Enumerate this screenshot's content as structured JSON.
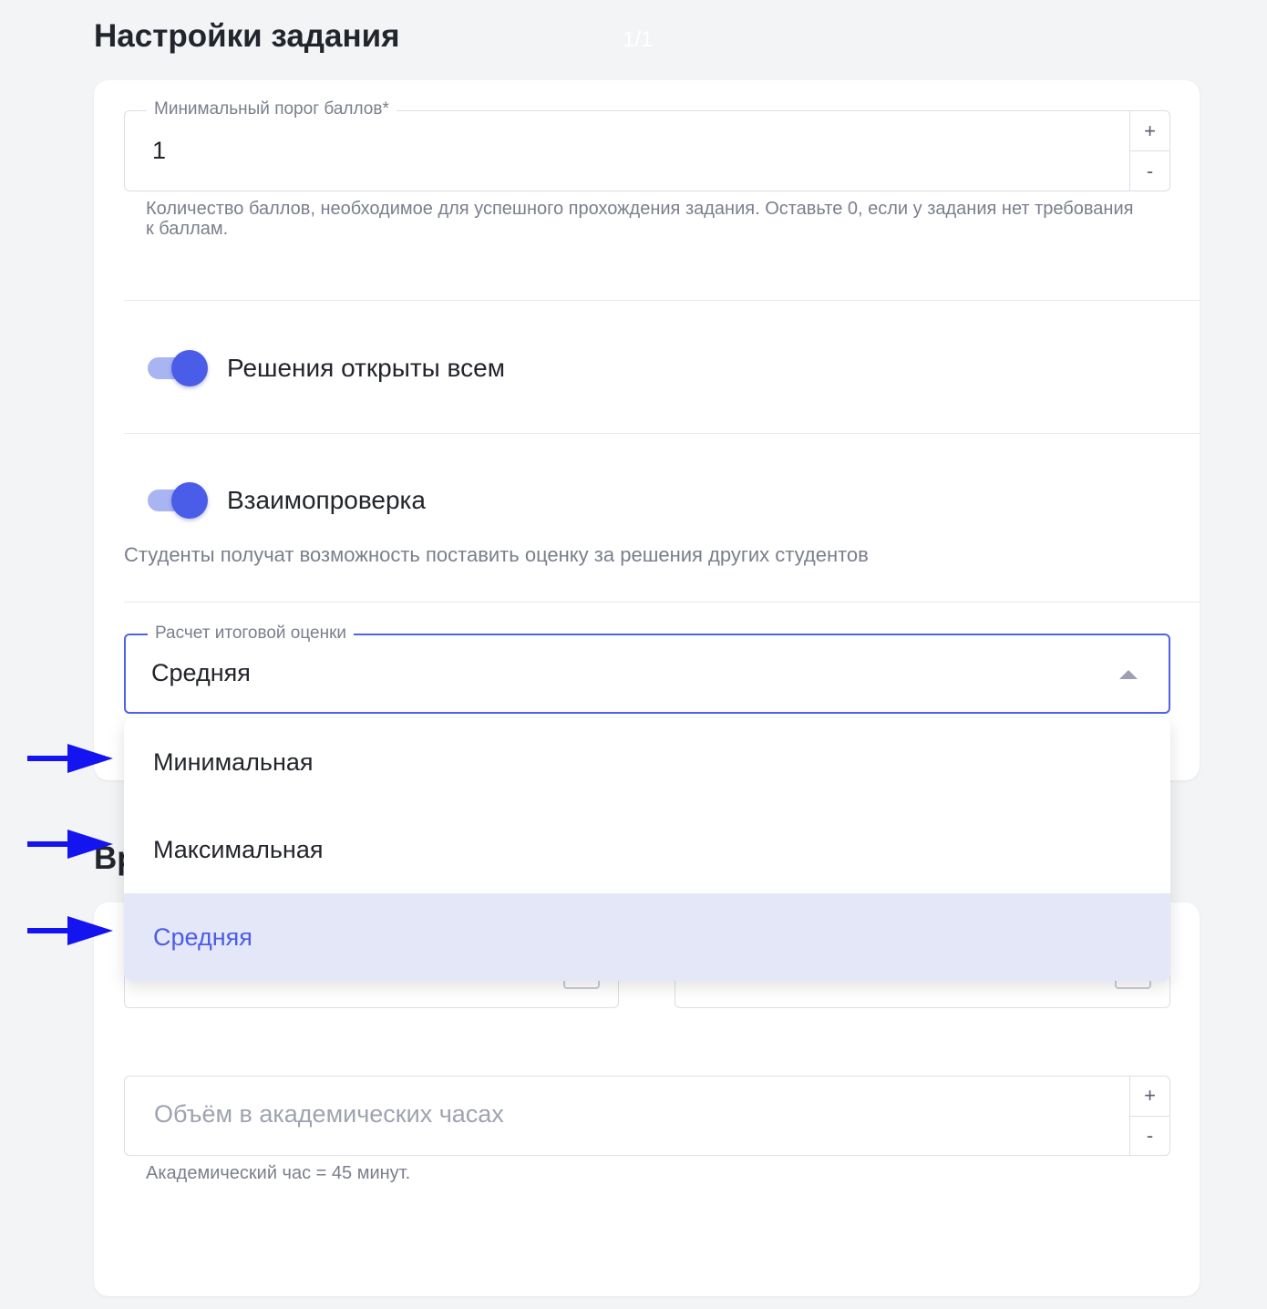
{
  "header": {
    "title": "Настройки задания",
    "counter": "1/1"
  },
  "threshold": {
    "legend": "Минимальный порог баллов*",
    "value": "1",
    "plus": "+",
    "minus": "-",
    "helper": "Количество баллов, необходимое для успешного прохождения задания. Оставьте 0, если у задания нет требования к баллам."
  },
  "toggles": {
    "solutions_open": {
      "label": "Решения открыты всем",
      "on": true
    },
    "peer_review": {
      "label": "Взаимопроверка",
      "on": true,
      "helper": "Студенты получат возможность поставить оценку за решения других студентов"
    }
  },
  "grade_calc": {
    "legend": "Расчет итоговой оценки",
    "value": "Средняя",
    "options": [
      "Минимальная",
      "Максимальная",
      "Средняя"
    ],
    "selected_index": 2
  },
  "section2": {
    "title_visible": "Вр"
  },
  "hours": {
    "placeholder": "Объём в академических часах",
    "plus": "+",
    "minus": "-",
    "helper": "Академический час = 45 минут."
  },
  "colors": {
    "accent": "#4a5de8",
    "arrow": "#1414f0",
    "selected_bg": "#e4e7f8"
  }
}
